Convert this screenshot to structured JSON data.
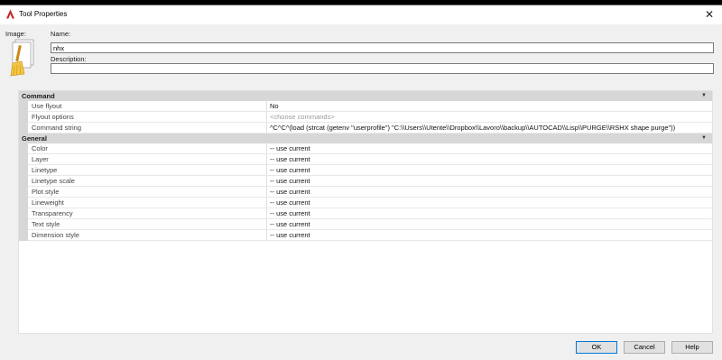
{
  "window": {
    "title": "Tool Properties",
    "app_icon": "autocad-a-icon",
    "close_icon": "close-icon"
  },
  "form": {
    "image_label": "Image:",
    "image_icon": "broom-tool-icon",
    "name_label": "Name:",
    "name_value": "nhx",
    "description_label": "Description:",
    "description_value": ""
  },
  "properties": {
    "command": {
      "title": "Command",
      "rows": [
        {
          "name": "Use flyout",
          "value": "No"
        },
        {
          "name": "Flyout options",
          "value": "<choose commands>"
        },
        {
          "name": "Command string",
          "value": "^C^C^(load (strcat (getenv \"userprofile\") \"C:\\\\Users\\\\Utente\\\\Dropbox\\\\Lavoro\\\\backup\\\\AUTOCAD\\\\Lisp\\\\PURGE\\\\RSHX shape purge\"))"
        }
      ]
    },
    "general": {
      "title": "General",
      "rows": [
        {
          "name": "Color",
          "value": "-- use current"
        },
        {
          "name": "Layer",
          "value": "-- use current"
        },
        {
          "name": "Linetype",
          "value": "-- use current"
        },
        {
          "name": "Linetype scale",
          "value": "-- use current"
        },
        {
          "name": "Plot style",
          "value": "-- use current"
        },
        {
          "name": "Lineweight",
          "value": "-- use current"
        },
        {
          "name": "Transparency",
          "value": "-- use current"
        },
        {
          "name": "Text style",
          "value": "-- use current"
        },
        {
          "name": "Dimension  style",
          "value": "-- use current"
        }
      ]
    }
  },
  "buttons": {
    "ok": "OK",
    "cancel": "Cancel",
    "help": "Help"
  },
  "colors": {
    "accent": "#0078d7",
    "category_bg": "#d7d7d7",
    "brand_red": "#c4262e"
  }
}
